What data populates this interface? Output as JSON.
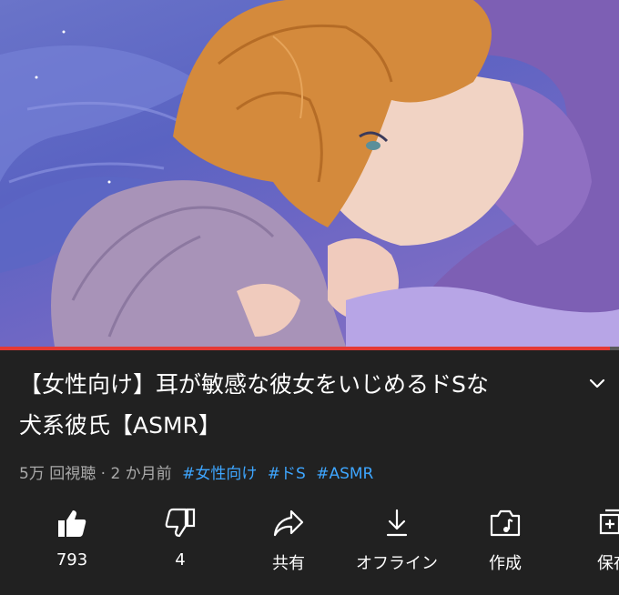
{
  "video": {
    "title_line1": "【女性向け】耳が敏感な彼女をいじめるドSな",
    "title_line2": "犬系彼氏【ASMR】",
    "progress_fraction": 0.985
  },
  "meta": {
    "views": "5万 回視聴",
    "separator": "·",
    "age": "2 か月前",
    "hashtags": [
      "#女性向け",
      "#ドS",
      "#ASMR"
    ]
  },
  "actions": [
    {
      "icon": "thumbs-up-icon",
      "label": "793"
    },
    {
      "icon": "thumbs-down-icon",
      "label": "4"
    },
    {
      "icon": "share-icon",
      "label": "共有"
    },
    {
      "icon": "download-icon",
      "label": "オフライン"
    },
    {
      "icon": "create-icon",
      "label": "作成"
    },
    {
      "icon": "save-icon",
      "label": "保存"
    }
  ],
  "colors": {
    "background": "#212121",
    "progress": "#e53935",
    "hashtag": "#3ea6ff",
    "meta_text": "#aaaaaa"
  }
}
